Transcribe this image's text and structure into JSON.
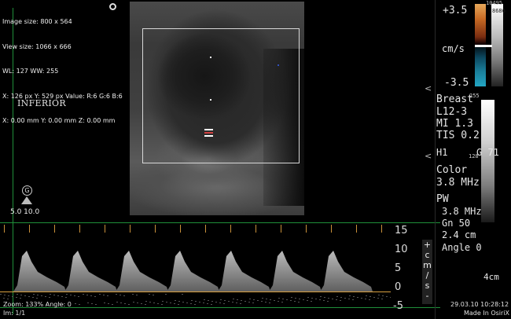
{
  "overlay": {
    "image_size": "Image size: 800 x 564",
    "view_size": "View size: 1066 x 666",
    "wl_ww": "WL: 127 WW: 255",
    "pixel": "X: 126 px Y: 529 px Value: R:6 G:6 B:6",
    "mm": "X: 0.00 mm Y: 0.00 mm Z: 0.00 mm"
  },
  "orientation_label": "INFERIOR",
  "marker_letter": "G",
  "scale_left": "5.0  10.0",
  "color_scale": {
    "top_value": "+3.5",
    "unit": "cm/s",
    "bottom_value": "-3.5",
    "top_number": "10495",
    "second_number": "8686"
  },
  "gray_scale": {
    "top": "255",
    "mid": "128"
  },
  "settings": {
    "preset": "Breast",
    "probe": "L12-3",
    "mi": "MI 1.3",
    "tis": "TIS 0.2",
    "h1": "H1",
    "gain": "G 71",
    "color_label": "Color",
    "color_freq": "3.8 MHz",
    "pw_label": "PW",
    "pw_freq": "3.8 MHz",
    "pw_gain": "Gn 50",
    "depth": "2.4 cm",
    "angle": "Angle 0",
    "depth_scale": "4cm"
  },
  "doppler_scale": [
    "15",
    "10",
    "5",
    "0",
    "-5"
  ],
  "doppler_unit": [
    "+",
    "c",
    "m",
    "/",
    "s",
    "-"
  ],
  "footer": {
    "zoom": "Zoom: 133% Angle: 0",
    "image_index": "Im: 1/1",
    "date": "29.03.10 10:28:12",
    "made_in": "Made In OsiriX"
  },
  "colors": {
    "accent_green": "#1f8f3a",
    "doppler_baseline": "#d9a040"
  }
}
